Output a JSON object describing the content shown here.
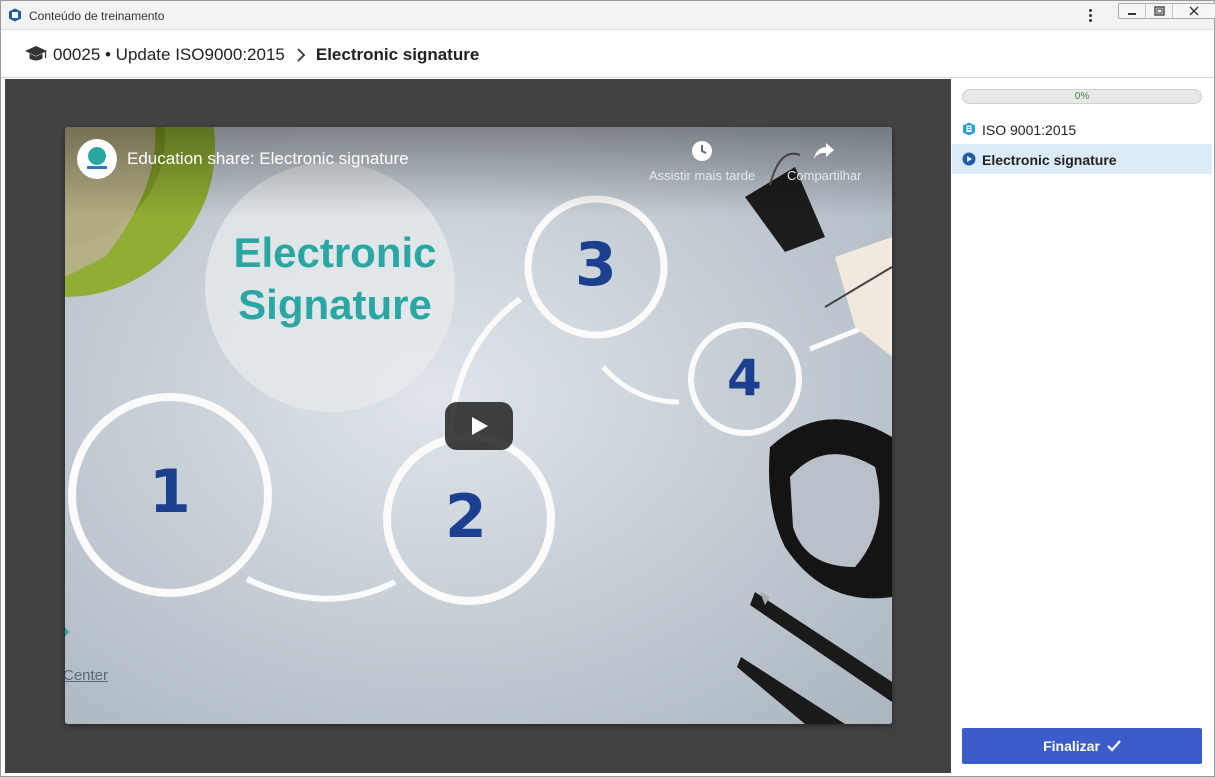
{
  "window": {
    "title": "Conteúdo de treinamento"
  },
  "breadcrumb": {
    "course": "00025 • Update ISO9000:2015",
    "current": "Electronic signature"
  },
  "video": {
    "title": "Education share: Electronic signature",
    "watch_later_label": "Assistir mais tarde",
    "share_label": "Compartilhar",
    "slide_title_line1": "Electronic",
    "slide_title_line2": "Signature",
    "numbers": [
      "1",
      "2",
      "3",
      "4"
    ],
    "bottom_text": "Center"
  },
  "sidebar": {
    "progress_value": 0,
    "progress_label": "0%",
    "items": [
      {
        "label": "ISO 9001:2015",
        "icon": "document-icon",
        "active": false
      },
      {
        "label": "Electronic signature",
        "icon": "play-circle-icon",
        "active": true
      }
    ],
    "finish_label": "Finalizar"
  },
  "colors": {
    "accent": "#3d5ccc",
    "active_row": "#dcebf8",
    "player_bg": "#424242",
    "slide_teal": "#2aa7a3",
    "slide_navy": "#1d3f8f"
  }
}
